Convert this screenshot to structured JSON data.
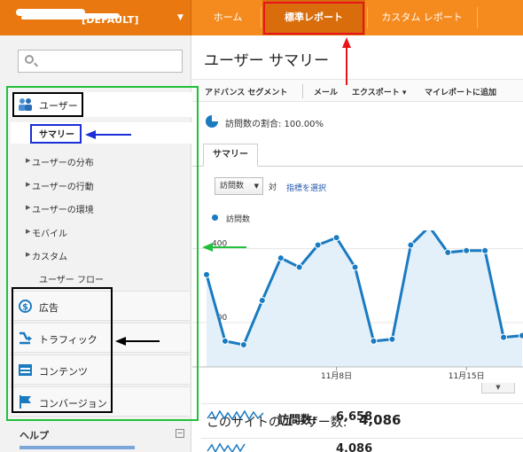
{
  "topnav": {
    "account_label": "[DEFAULT]",
    "tabs": [
      "ホーム",
      "標準レポート",
      "カスタム レポート"
    ]
  },
  "sidebar": {
    "search_placeholder": "",
    "users_label": "ユーザー",
    "summary_label": "サマリー",
    "sub_items": [
      "ユーザーの分布",
      "ユーザーの行動",
      "ユーザーの環境",
      "モバイル",
      "カスタム",
      "ユーザー フロー"
    ],
    "sections": [
      "広告",
      "トラフィック",
      "コンテンツ",
      "コンバージョン"
    ],
    "help_label": "ヘルプ"
  },
  "main": {
    "title": "ユーザー サマリー",
    "toolbar": [
      "アドバンス セグメント",
      "メール",
      "エクスポート ▾",
      "マイレポートに追加"
    ],
    "percent_text": "訪問数の割合: 100.00%",
    "summary_tab": "サマリー",
    "metric_select": "訪問数",
    "vs_text": "対",
    "pick_metric_link": "指標を選択",
    "big_stat_label": "このサイトのユーザー数:",
    "big_stat_value": "4,086",
    "spark_label": "訪問数:",
    "spark_value": "6,658",
    "spark2_value": "4,086"
  },
  "colors": {
    "accent": "#f58b1f",
    "line": "#1a7bc1",
    "annotation_green": "#22c03a",
    "annotation_red": "#e8141a",
    "annotation_blue": "#1a2fd6"
  },
  "chart_data": {
    "type": "area",
    "series": [
      {
        "name": "訪問数",
        "values": [
          330,
          150,
          140,
          260,
          375,
          350,
          410,
          430,
          350,
          150,
          155,
          410,
          460,
          390,
          395,
          395,
          160,
          165
        ]
      }
    ],
    "x_tick_labels": [
      "11月8日",
      "11月15日"
    ],
    "y_tick_labels": [
      "400",
      "200"
    ],
    "ylim": [
      80,
      440
    ]
  }
}
